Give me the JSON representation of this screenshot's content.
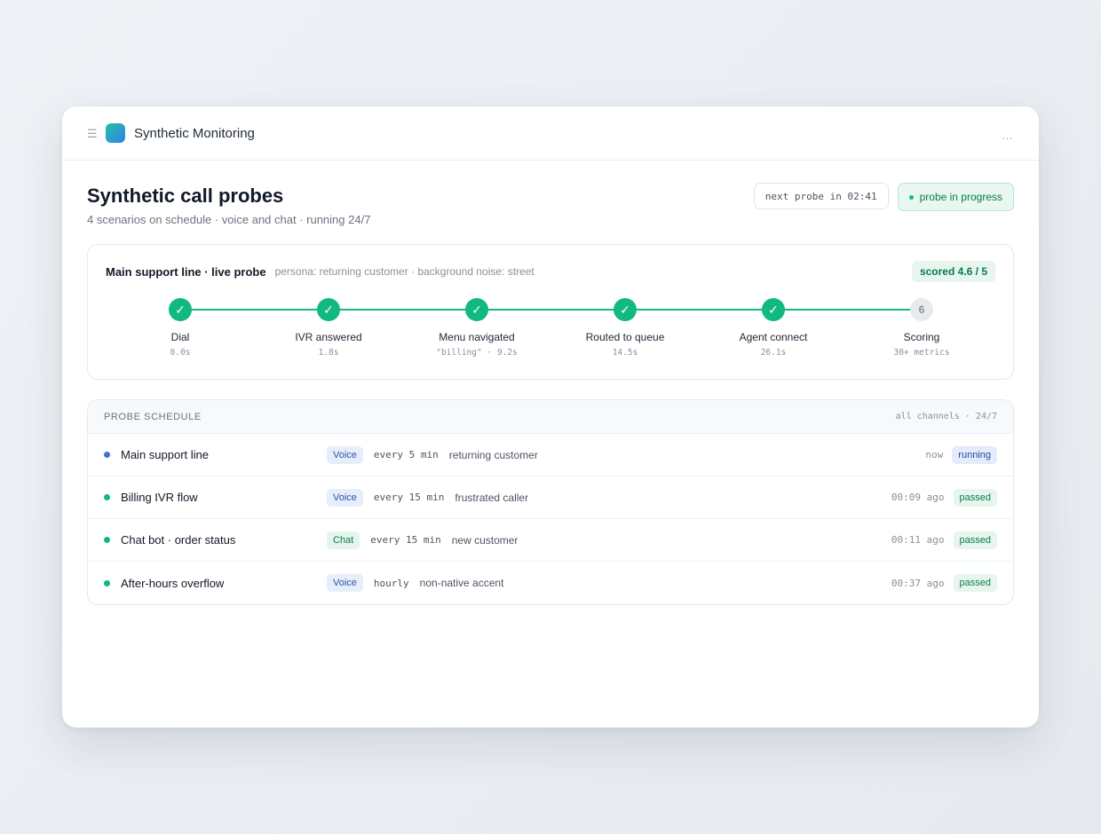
{
  "app": {
    "title": "Synthetic Monitoring",
    "menu_icon": "menu-icon",
    "more_icon": "more-icon"
  },
  "page": {
    "title": "Synthetic call probes",
    "subtitle": "4 scenarios on schedule · voice and chat · running 24/7",
    "next_probe": "next probe in 02:41",
    "progress_label": "probe in progress"
  },
  "live_probe": {
    "title": "Main support line · live probe",
    "meta": "persona: returning customer · background noise: street",
    "score": "scored 4.6 / 5",
    "steps": [
      {
        "label": "Dial",
        "sub": "0.0s",
        "state": "done",
        "marker": "✓"
      },
      {
        "label": "IVR answered",
        "sub": "1.8s",
        "state": "done",
        "marker": "✓"
      },
      {
        "label": "Menu navigated",
        "sub": "\"billing\" · 9.2s",
        "state": "done",
        "marker": "✓"
      },
      {
        "label": "Routed to queue",
        "sub": "14.5s",
        "state": "done",
        "marker": "✓"
      },
      {
        "label": "Agent connect",
        "sub": "26.1s",
        "state": "done",
        "marker": "✓"
      },
      {
        "label": "Scoring",
        "sub": "30+ metrics",
        "state": "pending",
        "marker": "6"
      }
    ]
  },
  "schedule": {
    "title": "Probe schedule",
    "meta": "all channels · 24/7",
    "rows": [
      {
        "name": "Main support line",
        "channel": "Voice",
        "channel_type": "voice",
        "freq": "every 5 min",
        "persona": "returning customer",
        "time": "now",
        "status": "running",
        "dot_color": "#3b73d9"
      },
      {
        "name": "Billing IVR flow",
        "channel": "Voice",
        "channel_type": "voice",
        "freq": "every 15 min",
        "persona": "frustrated caller",
        "time": "00:09 ago",
        "status": "passed",
        "dot_color": "#10b981"
      },
      {
        "name": "Chat bot · order status",
        "channel": "Chat",
        "channel_type": "chat",
        "freq": "every 15 min",
        "persona": "new customer",
        "time": "00:11 ago",
        "status": "passed",
        "dot_color": "#10b981"
      },
      {
        "name": "After-hours overflow",
        "channel": "Voice",
        "channel_type": "voice",
        "freq": "hourly",
        "persona": "non-native accent",
        "time": "00:37 ago",
        "status": "passed",
        "dot_color": "#10b981"
      }
    ]
  },
  "colors": {
    "accent_green": "#10b981",
    "accent_blue": "#3b73d9"
  }
}
